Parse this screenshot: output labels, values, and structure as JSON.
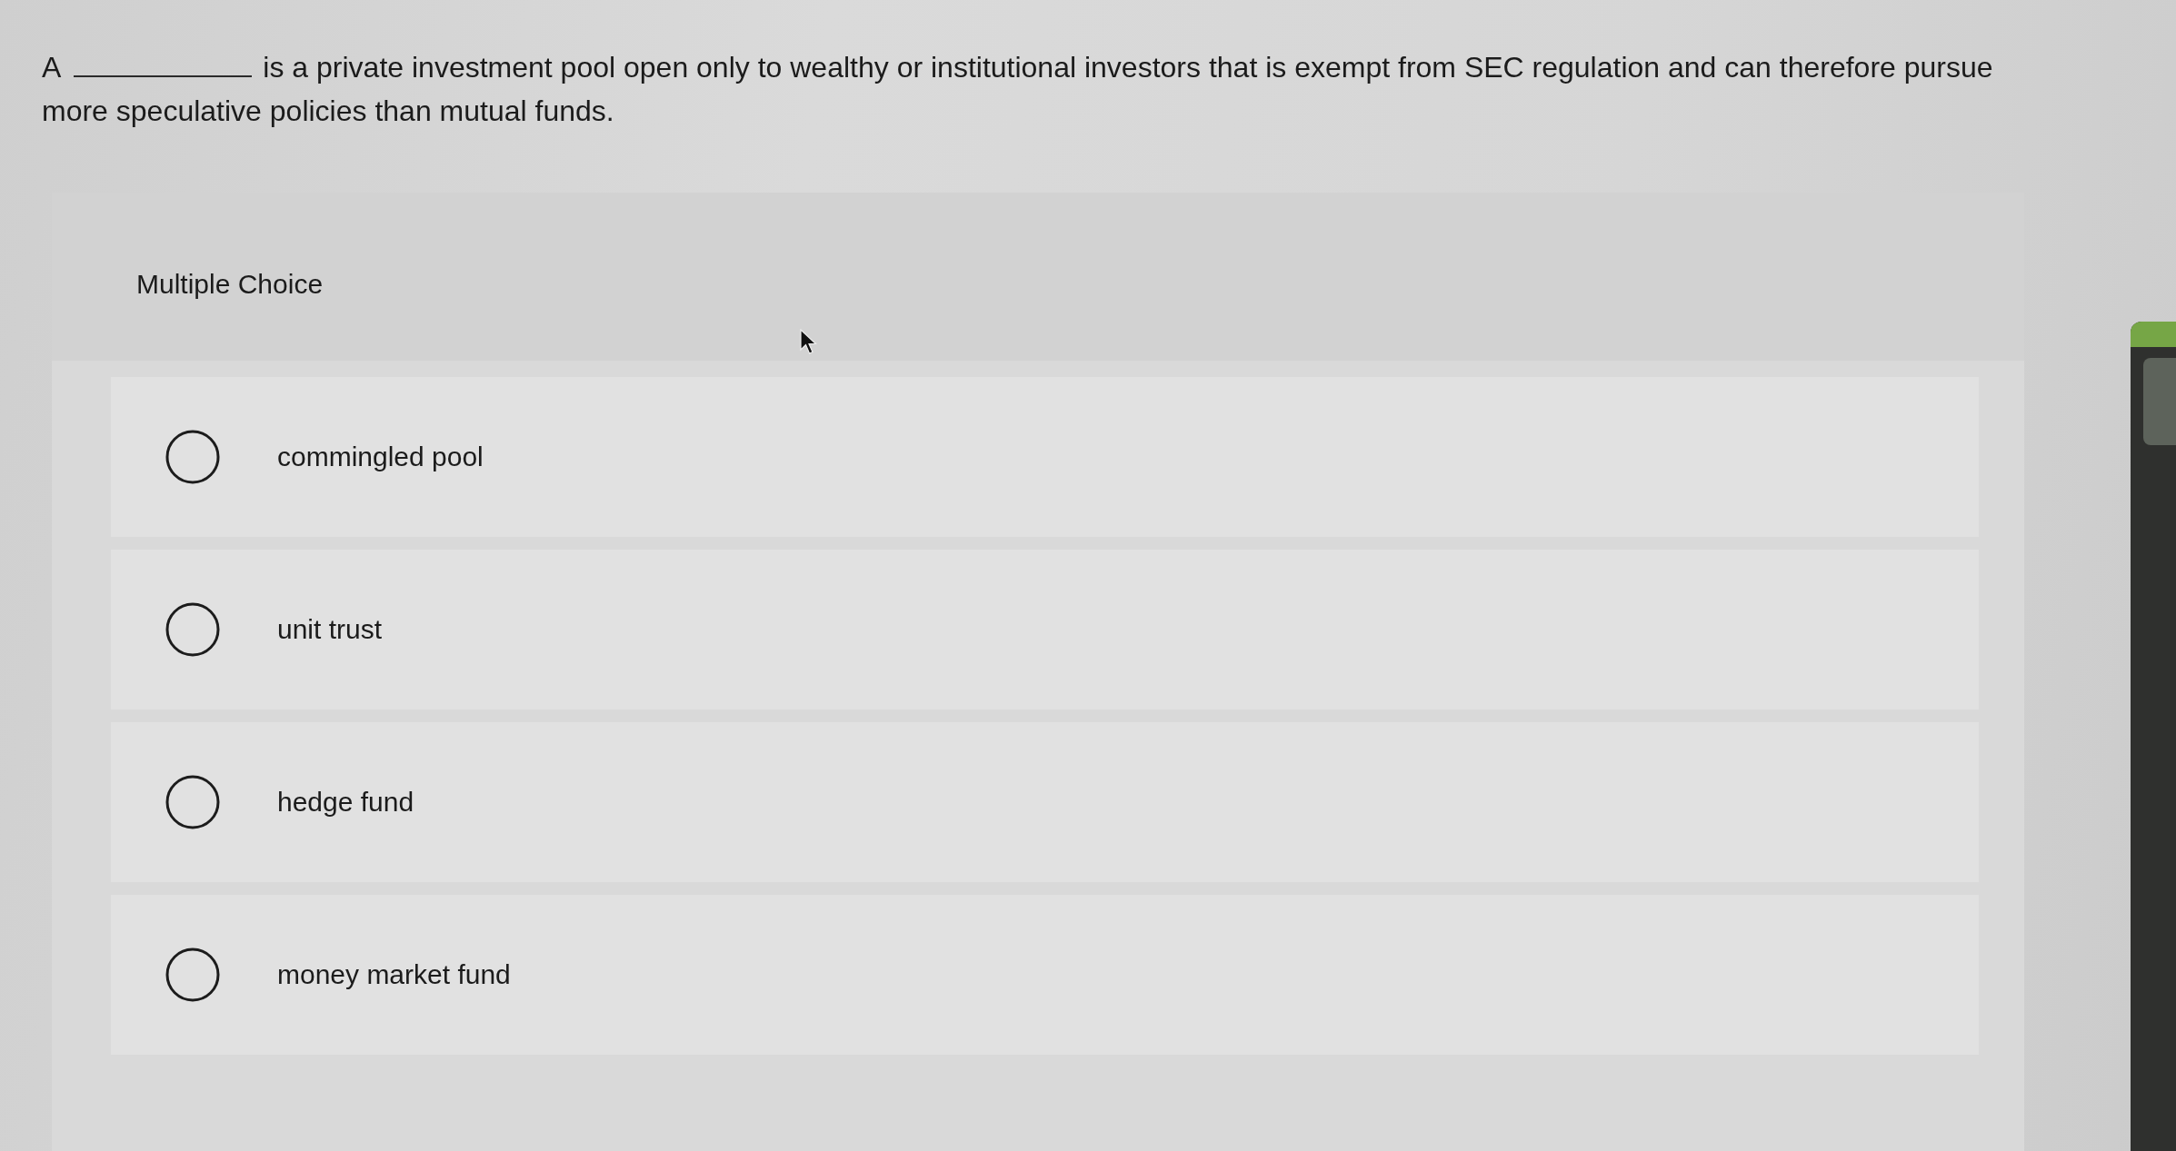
{
  "question": {
    "parts": [
      {
        "kind": "text",
        "text": "A"
      },
      {
        "kind": "blank"
      },
      {
        "kind": "text",
        "text": "is a private investment pool open only to wealthy or institutional investors that is exempt from SEC regulation and can therefore pursue more speculative policies than mutual funds."
      }
    ]
  },
  "answer_panel": {
    "title": "Multiple Choice",
    "choices": [
      {
        "label": "commingled pool",
        "selected": false
      },
      {
        "label": "unit trust",
        "selected": false
      },
      {
        "label": "hedge fund",
        "selected": false
      },
      {
        "label": "money market fund",
        "selected": false
      }
    ]
  }
}
